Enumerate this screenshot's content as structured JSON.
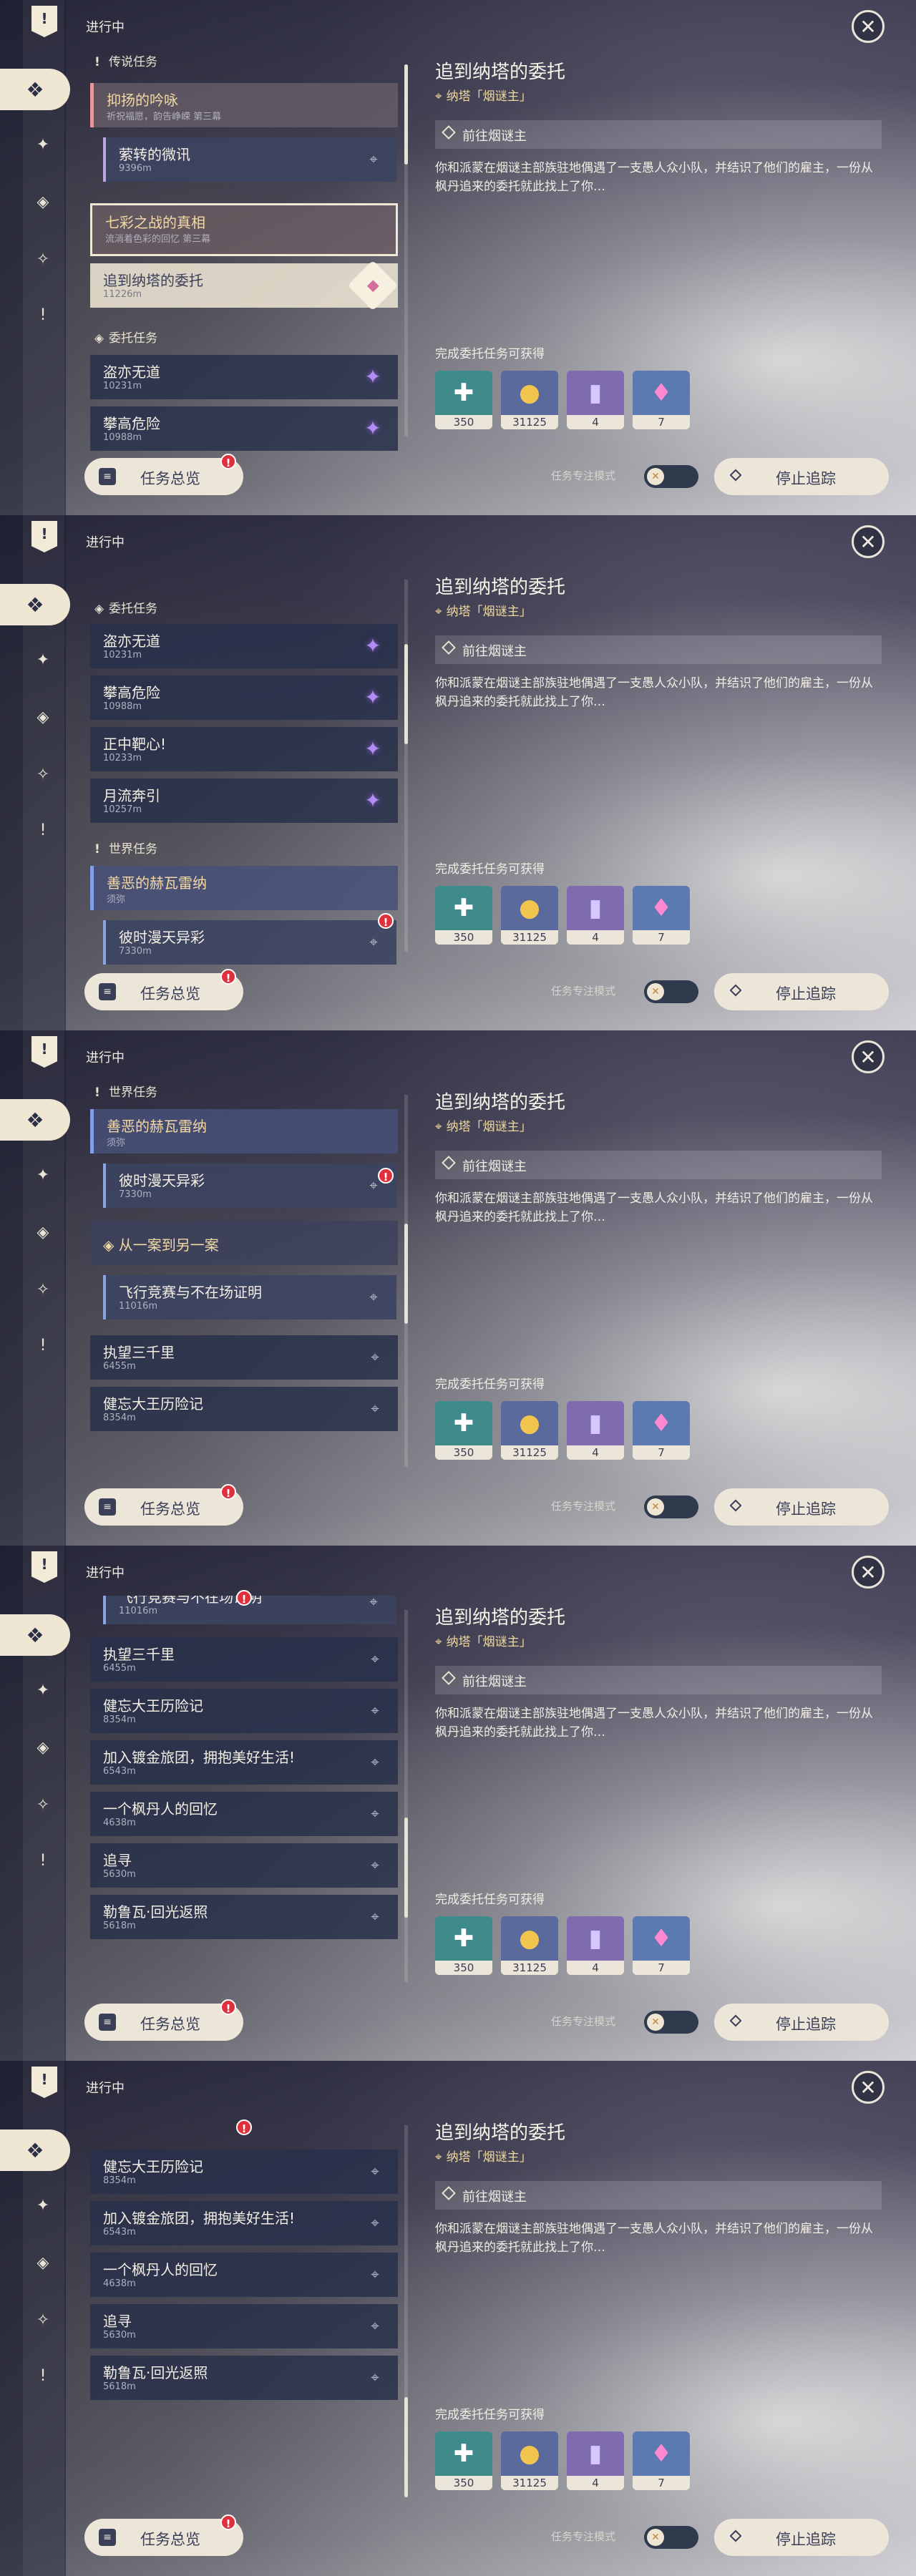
{
  "header": {
    "in_progress": "进行中",
    "close_icon": "✕"
  },
  "quest": {
    "title": "追到纳塔的委托",
    "location": "纳塔「烟谜主」",
    "objective": "前往烟谜主",
    "description": "你和派蒙在烟谜主部族驻地偶遇了一支愚人众小队，并结识了他们的雇主，一份从枫丹追来的委托就此找上了你…",
    "reward_label": "完成委托任务可获得",
    "rewards": [
      {
        "icon": "adventure-exp-icon",
        "count": "350"
      },
      {
        "icon": "mora-icon",
        "count": "31125"
      },
      {
        "icon": "hero-wit-book-icon",
        "count": "4"
      },
      {
        "icon": "crystal-ore-icon",
        "count": "7"
      }
    ]
  },
  "bottom": {
    "overview": "任务总览",
    "auto_track": "任务专注模式",
    "stop_track": "停止追踪"
  },
  "sections": {
    "legend": "传说任务",
    "commission": "委托任务",
    "world": "世界任务",
    "chain": "从一案到另一案"
  },
  "items": {
    "leg1_title": "抑扬的吟咏",
    "leg1_sub": "祈祝福愿，韵告峥嵘 第三幕",
    "leg1_child": "萦转的微讯",
    "leg1_child_d": "9396m",
    "leg2_title": "七彩之战的真相",
    "leg2_sub": "流淌着色彩的回忆 第三幕",
    "sel_title": "追到纳塔的委托",
    "sel_d": "11226m",
    "c1": "盗亦无道",
    "c1d": "10231m",
    "c2": "攀高危险",
    "c2d": "10988m",
    "c3": "正中靶心!",
    "c3d": "10233m",
    "c4": "月流奔引",
    "c4d": "10257m",
    "w1": "善恶的赫瓦雷纳",
    "w1d": "须弥",
    "w1c": "彼时漫天异彩",
    "w1cd": "7330m",
    "ch1": "飞行竞赛与不在场证明",
    "ch1d": "11016m",
    "ch2": "执望三千里",
    "ch2d": "6455m",
    "ch3": "健忘大王历险记",
    "ch3d": "8354m",
    "ch4": "加入镀金旅团，拥抱美好生活!",
    "ch4d": "6543m",
    "ch5": "一个枫丹人的回忆",
    "ch5d": "4638m",
    "ch6": "追寻",
    "ch6d": "5630m",
    "ch7": "勒鲁瓦·回光返照",
    "ch7d": "5618m"
  }
}
